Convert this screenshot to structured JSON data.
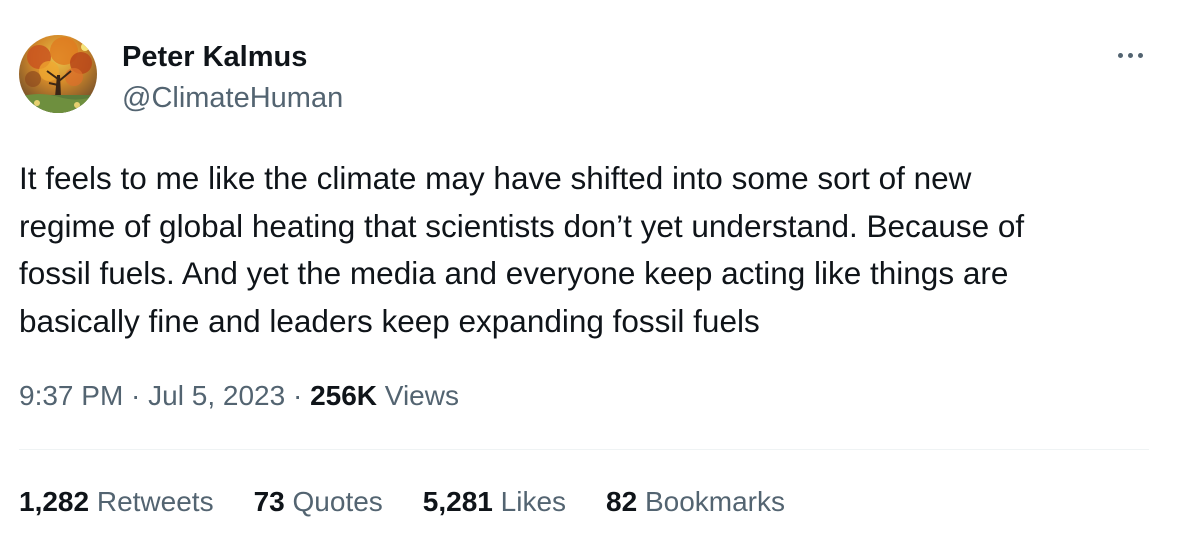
{
  "author": {
    "display_name": "Peter Kalmus",
    "handle": "@ClimateHuman"
  },
  "tweet": {
    "text": "It feels to me like the climate may have shifted into some sort of new\nregime of global heating that scientists don’t yet understand. Because of\nfossil fuels. And yet the media and everyone keep acting like things are\nbasically fine and leaders keep expanding fossil fuels",
    "time": "9:37 PM",
    "separator": " · ",
    "date": "Jul 5, 2023",
    "views_count": "256K",
    "views_label": "Views"
  },
  "stats": [
    {
      "count": "1,282",
      "label": "Retweets"
    },
    {
      "count": "73",
      "label": "Quotes"
    },
    {
      "count": "5,281",
      "label": "Likes"
    },
    {
      "count": "82",
      "label": "Bookmarks"
    }
  ],
  "icons": {
    "more": "more-horizontal-icon"
  },
  "colors": {
    "primary_text": "#0f1419",
    "secondary_text": "#536471",
    "divider": "#eff3f4"
  }
}
